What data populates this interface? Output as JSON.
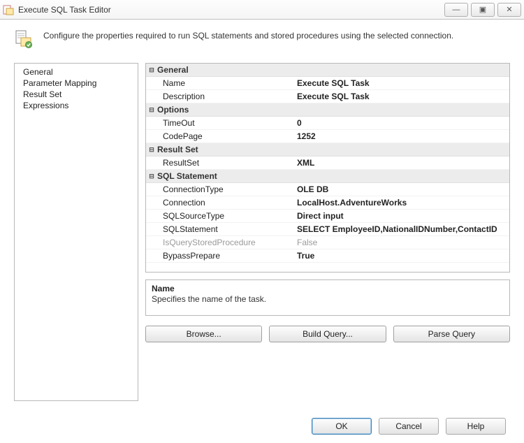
{
  "window": {
    "title": "Execute SQL Task Editor"
  },
  "header": {
    "text": "Configure the properties required to run SQL statements and stored procedures using the selected connection."
  },
  "nav": {
    "items": [
      "General",
      "Parameter Mapping",
      "Result Set",
      "Expressions"
    ]
  },
  "grid": {
    "sections": [
      {
        "title": "General",
        "rows": [
          {
            "label": "Name",
            "value": "Execute SQL Task"
          },
          {
            "label": "Description",
            "value": "Execute SQL Task"
          }
        ]
      },
      {
        "title": "Options",
        "rows": [
          {
            "label": "TimeOut",
            "value": "0"
          },
          {
            "label": "CodePage",
            "value": "1252"
          }
        ]
      },
      {
        "title": "Result Set",
        "rows": [
          {
            "label": "ResultSet",
            "value": "XML"
          }
        ]
      },
      {
        "title": "SQL Statement",
        "rows": [
          {
            "label": "ConnectionType",
            "value": "OLE DB"
          },
          {
            "label": "Connection",
            "value": "LocalHost.AdventureWorks"
          },
          {
            "label": "SQLSourceType",
            "value": "Direct input"
          },
          {
            "label": "SQLStatement",
            "value": "SELECT EmployeeID,NationalIDNumber,ContactID"
          },
          {
            "label": "IsQueryStoredProcedure",
            "value": "False",
            "disabled": true
          },
          {
            "label": "BypassPrepare",
            "value": "True"
          }
        ]
      }
    ]
  },
  "help": {
    "title": "Name",
    "desc": "Specifies the name of the task."
  },
  "buttons": {
    "browse": "Browse...",
    "build": "Build Query...",
    "parse": "Parse Query",
    "ok": "OK",
    "cancel": "Cancel",
    "help": "Help"
  },
  "glyphs": {
    "minimize": "―",
    "maximize": "▣",
    "close": "✕",
    "minus": "⊟"
  }
}
